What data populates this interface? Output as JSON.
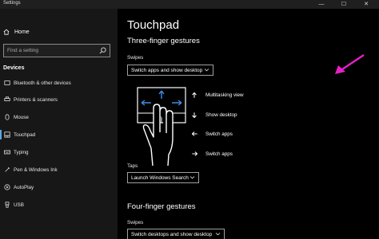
{
  "window": {
    "title": "Settings",
    "minimize": "—",
    "maximize": "☐",
    "close": "✕"
  },
  "sidebar": {
    "home_label": "Home",
    "search_placeholder": "Find a setting",
    "section_label": "Devices",
    "items": [
      {
        "label": "Bluetooth & other devices",
        "icon": "bluetooth-icon"
      },
      {
        "label": "Printers & scanners",
        "icon": "printer-icon"
      },
      {
        "label": "Mouse",
        "icon": "mouse-icon"
      },
      {
        "label": "Touchpad",
        "icon": "touchpad-icon",
        "active": true
      },
      {
        "label": "Typing",
        "icon": "keyboard-icon"
      },
      {
        "label": "Pen & Windows Ink",
        "icon": "pen-icon"
      },
      {
        "label": "AutoPlay",
        "icon": "autoplay-icon"
      },
      {
        "label": "USB",
        "icon": "usb-icon"
      }
    ]
  },
  "main": {
    "title": "Touchpad",
    "three_finger": {
      "heading": "Three-finger gestures",
      "swipes_label": "Swipes",
      "swipes_value": "Switch apps and show desktop",
      "gestures": [
        {
          "icon": "arrow-up-icon",
          "label": "Multitasking view"
        },
        {
          "icon": "arrow-down-icon",
          "label": "Show desktop"
        },
        {
          "icon": "arrow-left-icon",
          "label": "Switch apps"
        },
        {
          "icon": "arrow-right-icon",
          "label": "Switch apps"
        }
      ],
      "taps_label": "Taps",
      "taps_value": "Launch Windows Search"
    },
    "four_finger": {
      "heading": "Four-finger gestures",
      "swipes_label": "Swipes",
      "swipes_value": "Switch desktops and show desktop"
    }
  },
  "colors": {
    "accent": "#5aa7e6",
    "callout_arrow": "#e81fc8",
    "gesture_blue": "#3a8ee6"
  }
}
